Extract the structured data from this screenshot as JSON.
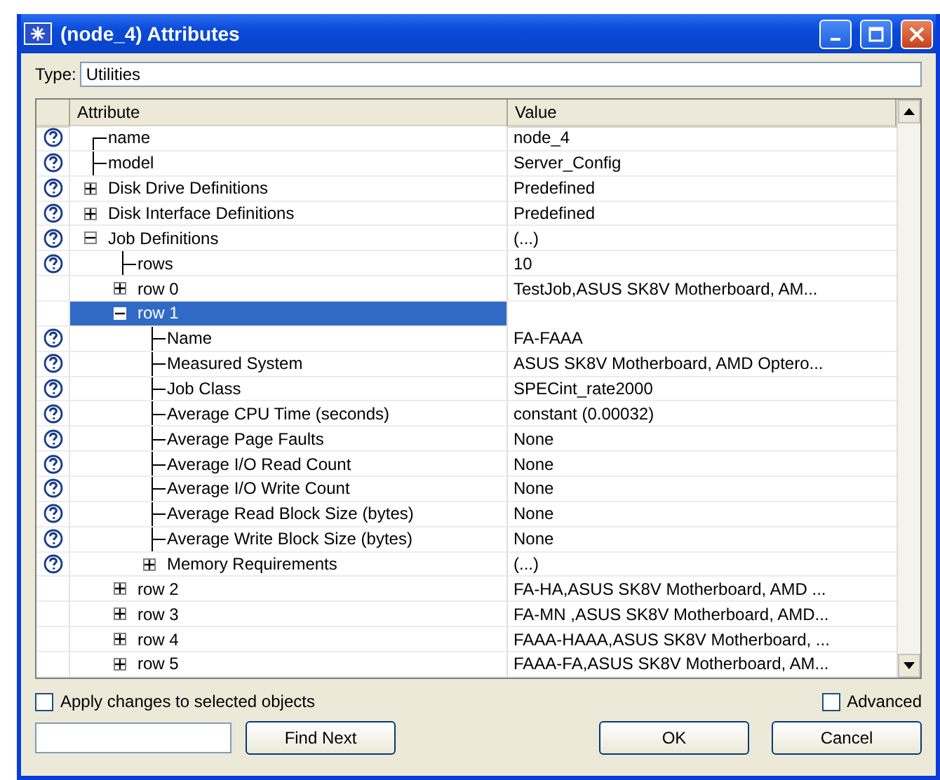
{
  "window": {
    "title": "(node_4) Attributes"
  },
  "type_field": {
    "label": "Type:",
    "value": "Utilities"
  },
  "table": {
    "columns": [
      "Attribute",
      "Value"
    ],
    "rows": [
      {
        "label": "name",
        "value": "node_4",
        "help": true,
        "kind": "leaf",
        "selected": false
      },
      {
        "label": "model",
        "value": "Server_Config",
        "help": true,
        "kind": "leaf",
        "selected": false
      },
      {
        "label": "Disk Drive Definitions",
        "value": "Predefined",
        "help": true,
        "kind": "group",
        "expanded": false,
        "selected": false
      },
      {
        "label": "Disk Interface Definitions",
        "value": "Predefined",
        "help": true,
        "kind": "group",
        "expanded": false,
        "selected": false
      },
      {
        "label": "Job Definitions",
        "value": "(...)",
        "help": true,
        "kind": "group",
        "expanded": true,
        "selected": false,
        "children": [
          {
            "label": "rows",
            "value": "10",
            "help": true,
            "kind": "leaf",
            "selected": false
          },
          {
            "label": "row 0",
            "value": "TestJob,ASUS SK8V Motherboard, AM...",
            "help": false,
            "kind": "group",
            "expanded": false,
            "selected": false
          },
          {
            "label": "row 1",
            "help": false,
            "kind": "group",
            "expanded": true,
            "selected": true,
            "children": [
              {
                "label": "Name",
                "value": "FA-FAAA",
                "help": true,
                "kind": "leaf",
                "selected": false
              },
              {
                "label": "Measured System",
                "value": "ASUS SK8V Motherboard, AMD Optero...",
                "help": true,
                "kind": "leaf",
                "selected": false
              },
              {
                "label": "Job Class",
                "value": "SPECint_rate2000",
                "help": true,
                "kind": "leaf",
                "selected": false
              },
              {
                "label": "Average CPU Time (seconds)",
                "value": "constant (0.00032)",
                "help": true,
                "kind": "leaf",
                "selected": false
              },
              {
                "label": "Average Page Faults",
                "value": "None",
                "help": true,
                "kind": "leaf",
                "selected": false
              },
              {
                "label": "Average I/O Read Count",
                "value": "None",
                "help": true,
                "kind": "leaf",
                "selected": false
              },
              {
                "label": "Average I/O Write Count",
                "value": "None",
                "help": true,
                "kind": "leaf",
                "selected": false
              },
              {
                "label": "Average Read Block Size (bytes)",
                "value": "None",
                "help": true,
                "kind": "leaf",
                "selected": false
              },
              {
                "label": "Average Write Block Size (bytes)",
                "value": "None",
                "help": true,
                "kind": "leaf",
                "selected": false
              },
              {
                "label": "Memory Requirements",
                "value": "(...)",
                "help": true,
                "kind": "group",
                "expanded": false,
                "selected": false
              }
            ]
          },
          {
            "label": "row 2",
            "value": "FA-HA,ASUS SK8V Motherboard, AMD ...",
            "help": false,
            "kind": "group",
            "expanded": false,
            "selected": false
          },
          {
            "label": "row 3",
            "value": "FA-MN ,ASUS SK8V Motherboard, AMD...",
            "help": false,
            "kind": "group",
            "expanded": false,
            "selected": false
          },
          {
            "label": "row 4",
            "value": "FAAA-HAAA,ASUS SK8V Motherboard, ...",
            "help": false,
            "kind": "group",
            "expanded": false,
            "selected": false
          },
          {
            "label": "row 5",
            "value": "FAAA-FA,ASUS SK8V Motherboard, AM...",
            "help": false,
            "kind": "group",
            "expanded": false,
            "selected": false
          }
        ]
      }
    ]
  },
  "apply_checkbox": {
    "label": "Apply changes to selected objects",
    "checked": false
  },
  "advanced_checkbox": {
    "label": "Advanced",
    "checked": false
  },
  "find_button": "Find Next",
  "ok_button": "OK",
  "cancel_button": "Cancel"
}
